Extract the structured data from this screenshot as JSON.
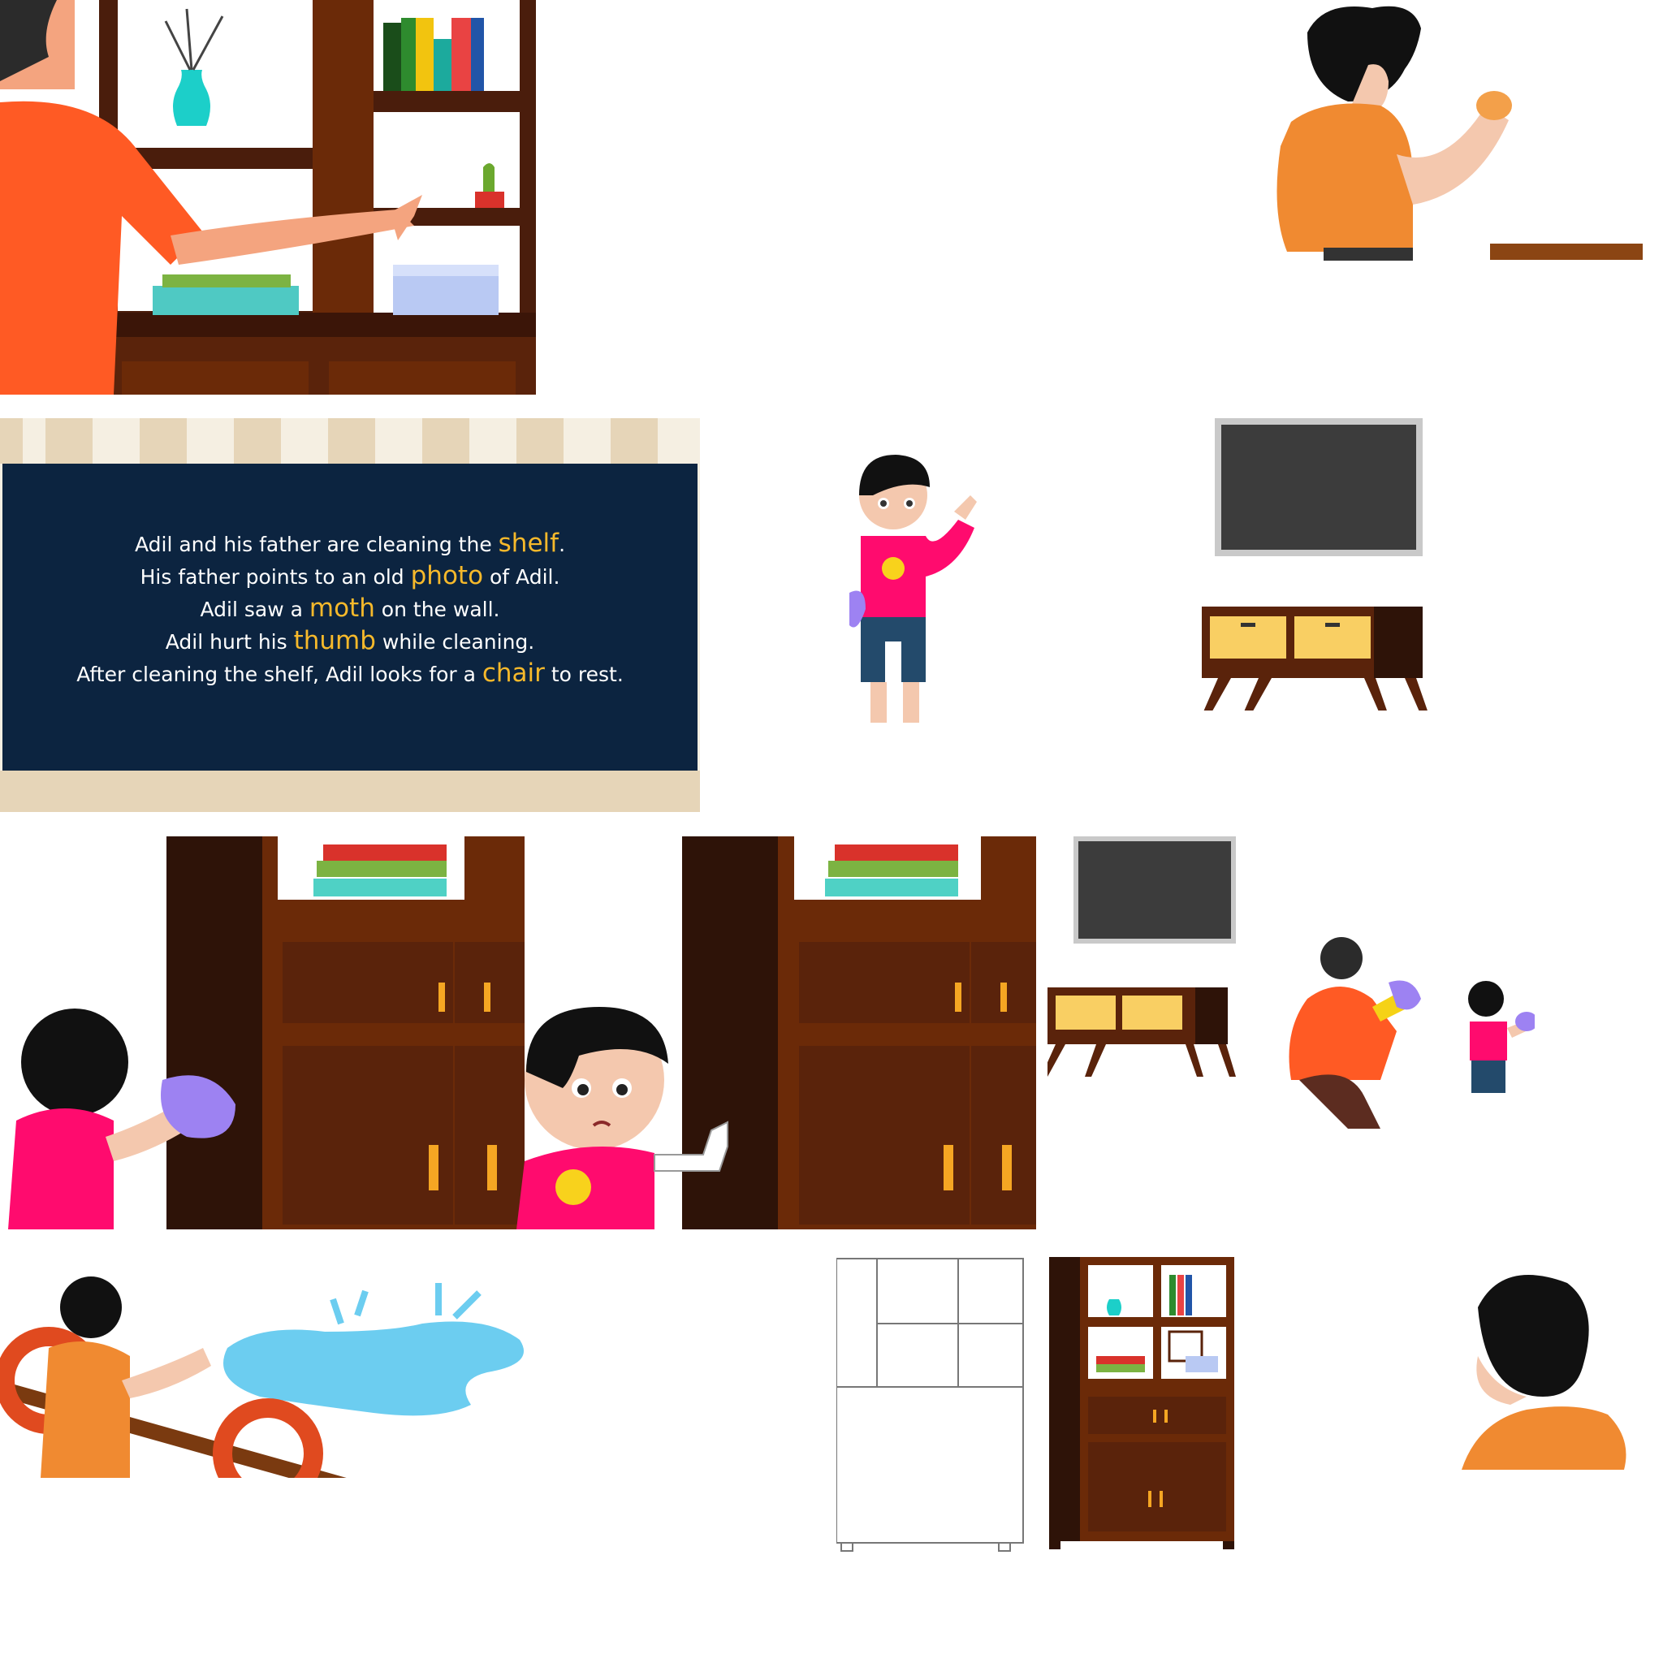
{
  "story": {
    "lines": [
      {
        "before": "Adil and his father are cleaning the ",
        "keyword": "shelf",
        "after": "."
      },
      {
        "before": "His father points to an old ",
        "keyword": "photo",
        "after": " of Adil."
      },
      {
        "before": "Adil saw a ",
        "keyword": "moth",
        "after": " on the wall."
      },
      {
        "before": "Adil hurt his ",
        "keyword": "thumb",
        "after": " while cleaning."
      },
      {
        "before": "After cleaning the shelf, Adil looks for a ",
        "keyword": "chair",
        "after": " to rest."
      }
    ]
  },
  "colors": {
    "story_panel": "#0c2440",
    "keyword": "#f6b92b",
    "wood_dark": "#2e1308",
    "wood": "#6b2a08",
    "father_shirt": "#ff5a24",
    "boy_shirt": "#ff0b6e"
  },
  "assets": [
    {
      "name": "father-pointing-at-shelf",
      "icon": "father-shelf-illustration"
    },
    {
      "name": "father-holding-shell",
      "icon": "father-shell-illustration"
    },
    {
      "name": "boy-waving-with-cloth",
      "icon": "boy-waving-illustration"
    },
    {
      "name": "tv-and-cabinet",
      "icon": "tv-cabinet-illustration"
    },
    {
      "name": "boy-wiping-cupboard",
      "icon": "boy-cleaning-illustration"
    },
    {
      "name": "boy-thumbs-up",
      "icon": "boy-thumbs-up-illustration"
    },
    {
      "name": "father-and-son-cleaning",
      "icon": "family-cleaning-illustration"
    },
    {
      "name": "father-at-pool-with-life-rings",
      "icon": "pool-illustration"
    },
    {
      "name": "shelf-outline-and-colored",
      "icon": "shelf-pair-illustration"
    },
    {
      "name": "father-head-back-view",
      "icon": "father-head-illustration"
    }
  ]
}
